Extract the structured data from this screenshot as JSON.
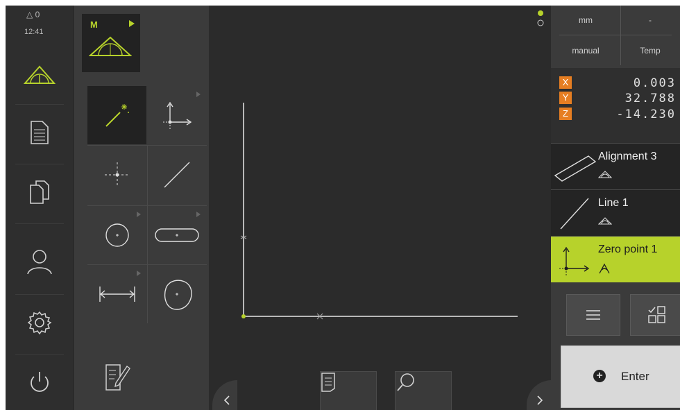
{
  "status": {
    "delta_label": "△ 0",
    "time": "12:41"
  },
  "nav": {
    "items": [
      "measure",
      "protocol",
      "file-management",
      "user-login",
      "settings",
      "switch-off"
    ]
  },
  "tools": {
    "mode_label": "M",
    "grid": [
      "measure-magic-wand",
      "zero-point",
      "point",
      "line",
      "circle",
      "slot",
      "distance",
      "blob"
    ]
  },
  "right": {
    "unit": "mm",
    "unit_secondary": "-",
    "mode": "manual",
    "temp": "Temp",
    "coords": [
      {
        "axis": "X",
        "value": "0.003"
      },
      {
        "axis": "Y",
        "value": "32.788"
      },
      {
        "axis": "Z",
        "value": "-14.230"
      }
    ],
    "features": [
      {
        "name": "Alignment 3"
      },
      {
        "name": "Line 1"
      },
      {
        "name": "Zero point 1"
      }
    ],
    "enter_label": "Enter"
  },
  "colors": {
    "accent": "#b7d22b",
    "axis": "#e67e22",
    "bg": "#2b2b2b",
    "panel": "#3b3b3b"
  }
}
